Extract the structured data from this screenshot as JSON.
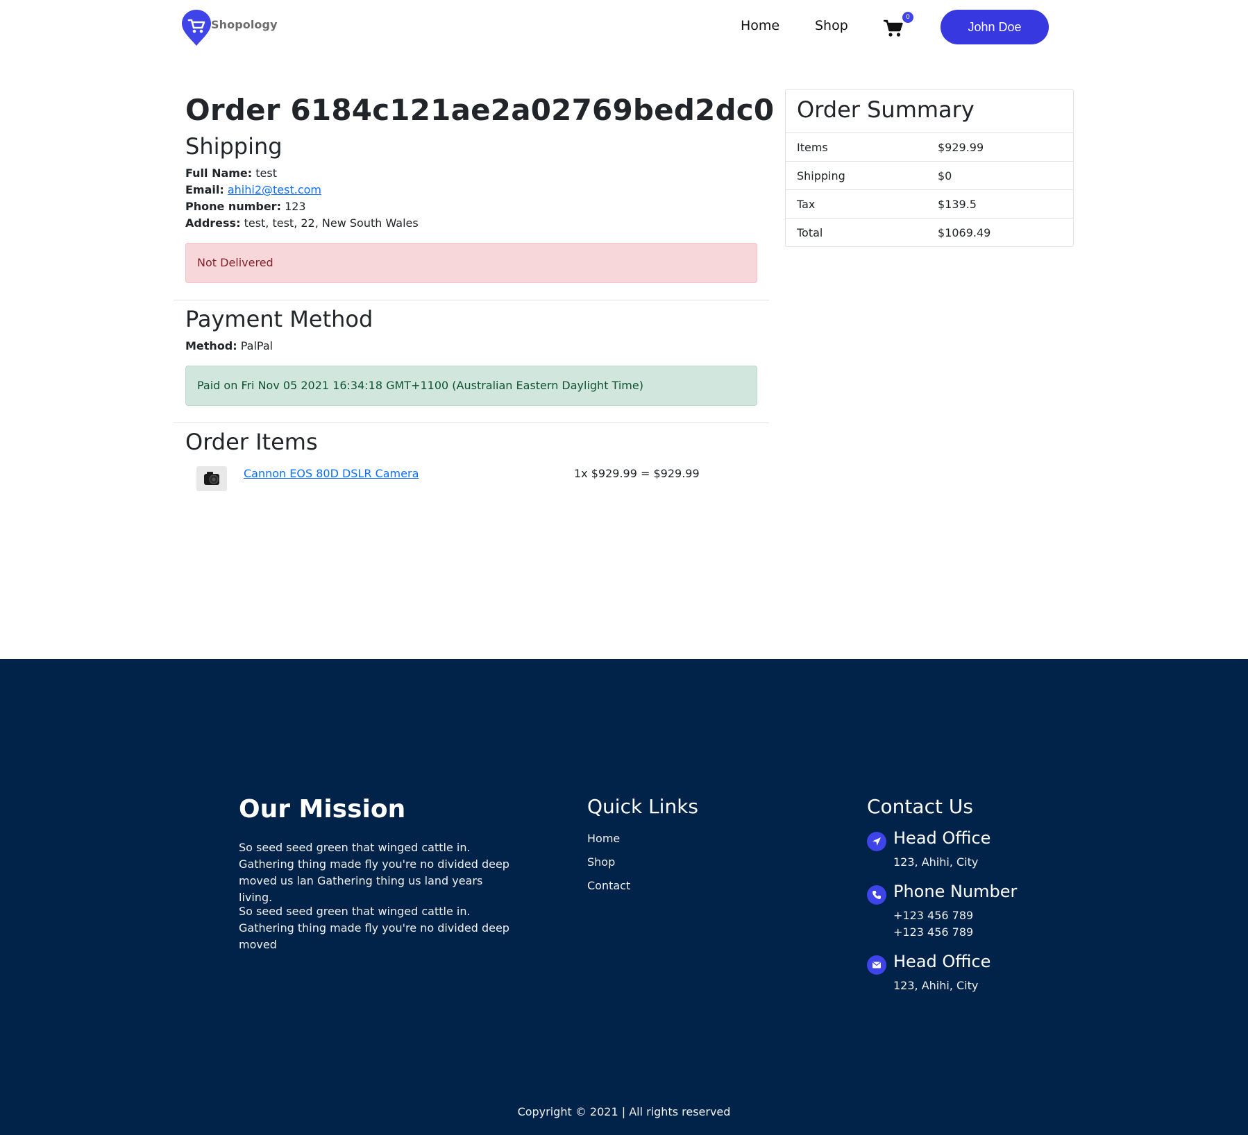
{
  "header": {
    "brand": "Shopology",
    "nav": {
      "home": "Home",
      "shop": "Shop"
    },
    "cart_count": "0",
    "user_label": "John Doe",
    "accent_color": "#3838e0"
  },
  "order": {
    "title": "Order 6184c121ae2a02769bed2dc0",
    "shipping_heading": "Shipping",
    "full_name_label": "Full Name:",
    "full_name": "test",
    "email_label": "Email:",
    "email": "ahihi2@test.com",
    "phone_label": "Phone number:",
    "phone": "123",
    "address_label": "Address:",
    "address": "test, test, 22, New South Wales",
    "delivery_status": "Not Delivered",
    "payment_heading": "Payment Method",
    "method_label": "Method:",
    "method": "PalPal",
    "payment_status": "Paid on Fri Nov 05 2021 16:34:18 GMT+1100 (Australian Eastern Daylight Time)",
    "items_heading": "Order Items",
    "items": [
      {
        "name": "Cannon EOS 80D DSLR Camera",
        "price_line": "1x $929.99 = $929.99"
      }
    ]
  },
  "summary": {
    "title": "Order Summary",
    "rows": [
      {
        "label": "Items",
        "value": "$929.99"
      },
      {
        "label": "Shipping",
        "value": "$0"
      },
      {
        "label": "Tax",
        "value": "$139.5"
      },
      {
        "label": "Total",
        "value": "$1069.49"
      }
    ]
  },
  "footer": {
    "mission_heading": "Our Mission",
    "mission_p1": "So seed seed green that winged cattle in. Gathering thing made fly you're no divided deep moved us lan Gathering thing us land years living.",
    "mission_p2": "So seed seed green that winged cattle in. Gathering thing made fly you're no divided deep moved",
    "quick_heading": "Quick Links",
    "quick_links": [
      "Home",
      "Shop",
      "Contact"
    ],
    "contact_heading": "Contact Us",
    "contacts": [
      {
        "icon": "location-arrow-icon",
        "title": "Head Office",
        "lines": [
          "123, Ahihi, City"
        ]
      },
      {
        "icon": "phone-icon",
        "title": "Phone Number",
        "lines": [
          "+123 456 789",
          "+123 456 789"
        ]
      },
      {
        "icon": "envelope-icon",
        "title": "Head Office",
        "lines": [
          "123, Ahihi, City"
        ]
      }
    ],
    "copyright": "Copyright © 2021 | All rights reserved",
    "background_color": "#01234a"
  }
}
